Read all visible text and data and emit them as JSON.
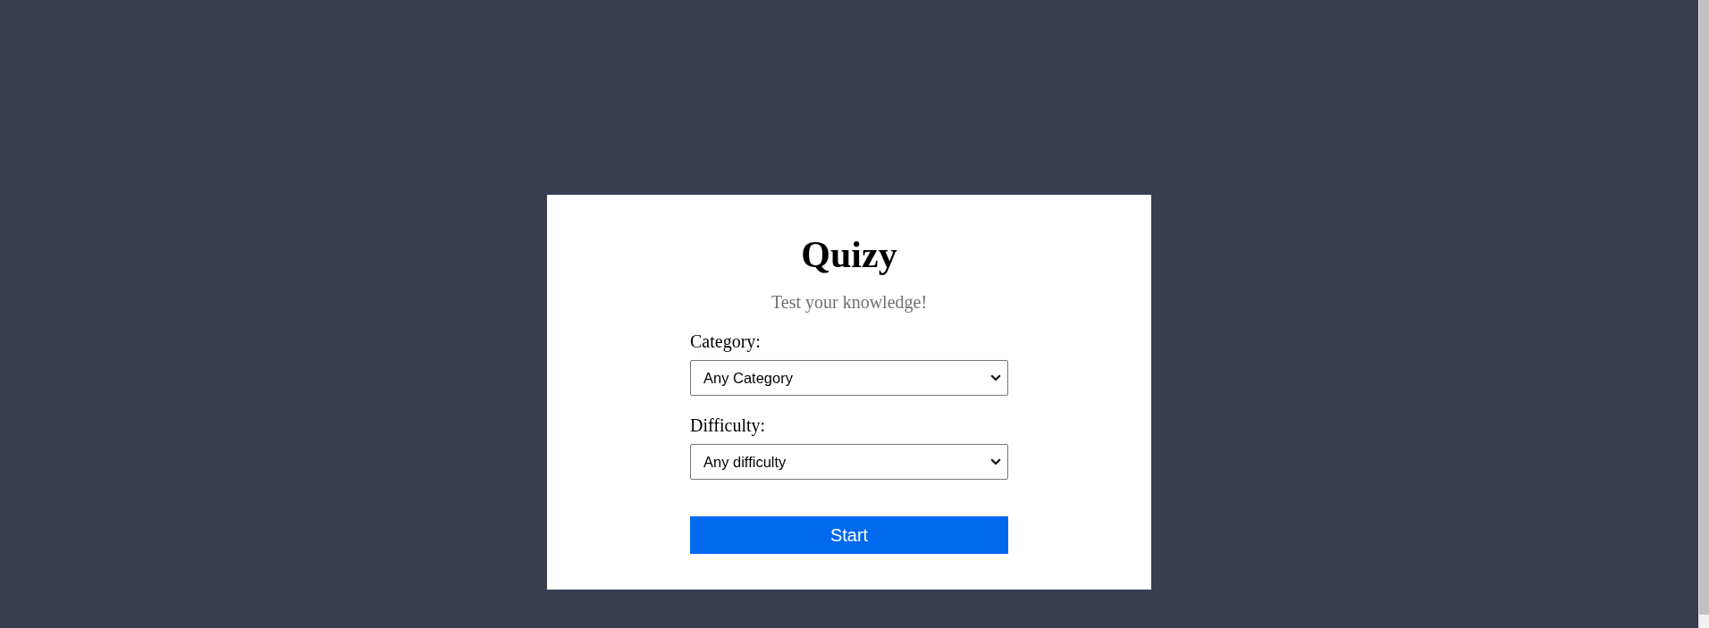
{
  "app": {
    "title": "Quizy",
    "subtitle": "Test your knowledge!"
  },
  "fields": [
    {
      "label": "Category:",
      "value": "Any Category"
    },
    {
      "label": "Difficulty:",
      "value": "Any difficulty"
    }
  ],
  "start_button": {
    "label": "Start"
  }
}
